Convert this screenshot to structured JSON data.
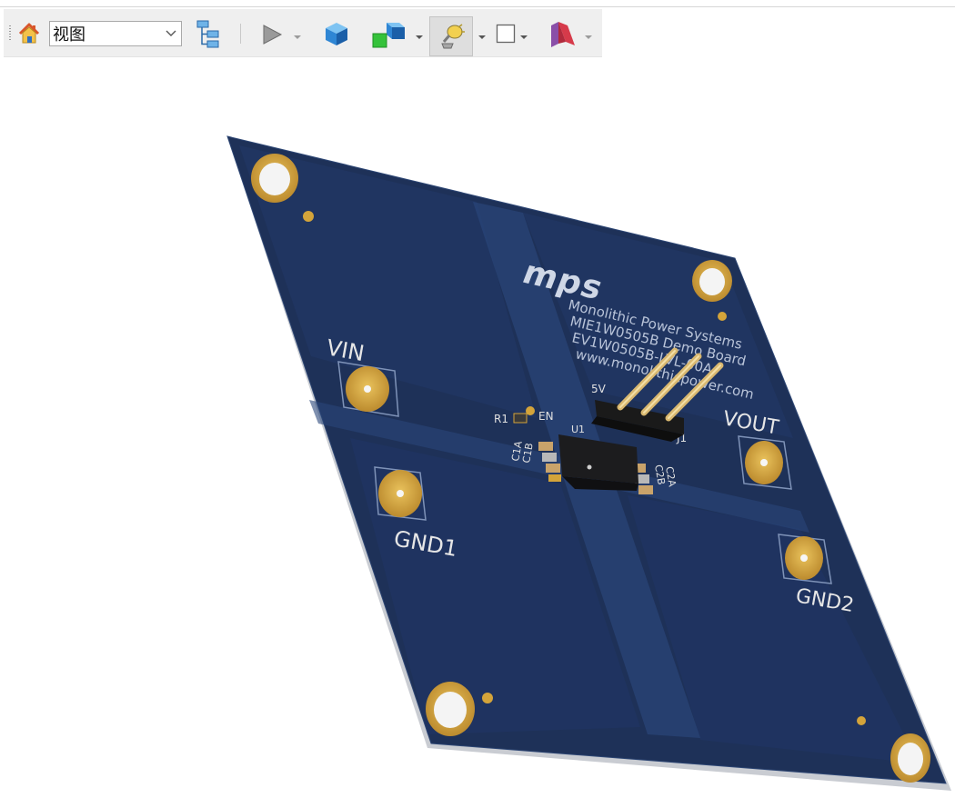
{
  "toolbar": {
    "view_combo": {
      "value": "视图"
    },
    "icons": [
      "home-icon",
      "model-tree-icon",
      "play-icon",
      "cube-icon",
      "display-style-icon",
      "light-bulb-icon",
      "render-box-icon",
      "section-view-icon"
    ]
  },
  "board": {
    "logo": "mps",
    "lines": [
      "Monolithic Power Systems",
      "MIE1W0505B Demo Board",
      "EV1W0505B-LVL-00A",
      "www.monolithicpower.com"
    ],
    "labels": {
      "vin": "VIN",
      "gnd1": "GND1",
      "vout": "VOUT",
      "gnd2": "GND2",
      "r1": "R1",
      "en": "EN",
      "u1": "U1",
      "j1": "J1",
      "fivev": "5V",
      "c1a": "C1A",
      "c1b": "C1B",
      "c2a": "C2A",
      "c2b": "C2B"
    }
  },
  "colors": {
    "pcb": "#1e3158",
    "copper": "#d4a43a",
    "toolbar": "#efefef"
  }
}
